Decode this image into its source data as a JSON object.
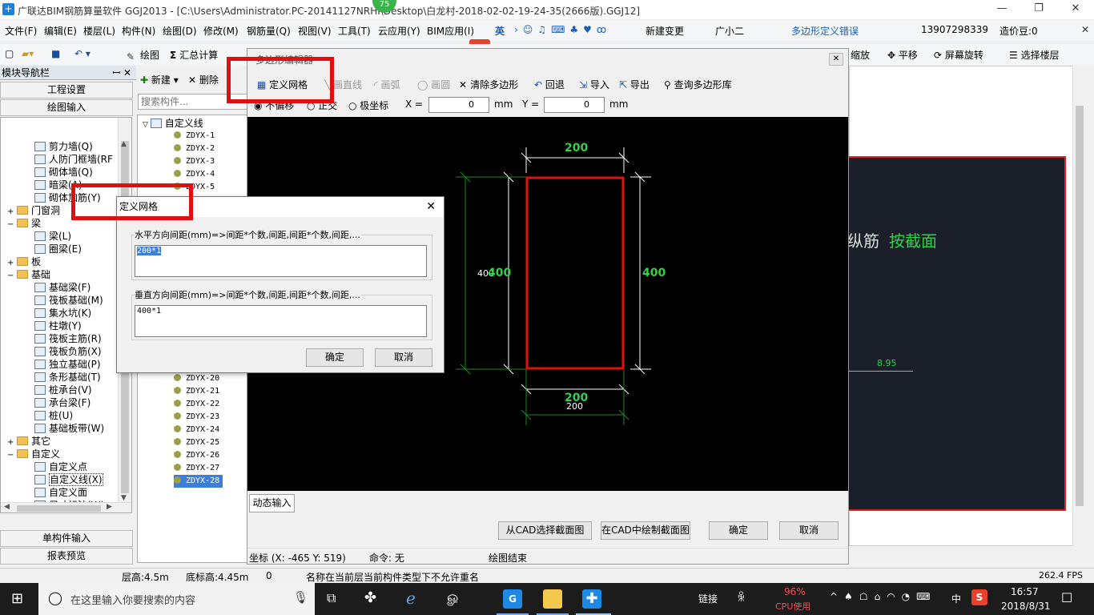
{
  "app": {
    "title": "广联达BIM钢筋算量软件 GGJ2013 - [C:\\Users\\Administrator.PC-20141127NRHI\\Desktop\\白龙村-2018-02-02-19-24-35(2666版).GGJ12]",
    "badge": "75"
  },
  "menu": {
    "items": [
      "文件(F)",
      "编辑(E)",
      "楼层(L)",
      "构件(N)",
      "绘图(D)",
      "修改(M)",
      "钢筋量(Q)",
      "视图(V)",
      "工具(T)",
      "云应用(Y)",
      "BIM应用(I)"
    ],
    "ime": "英",
    "new_change": "新建变更",
    "assistant": "广小二",
    "error_msg": "多边形定义错误",
    "phone": "13907298339",
    "cost": "造价豆:0"
  },
  "toolbar": {
    "draw": "绘图",
    "sum": "汇总计算",
    "zoom": "缩放",
    "pan": "平移",
    "rotate": "屏幕旋转",
    "select_floor": "选择楼层"
  },
  "nav": {
    "title": "模块导航栏",
    "pin": "꜖ ×",
    "project_settings": "工程设置",
    "drawing_input": "绘图输入",
    "single_input": "单构件输入",
    "report": "报表预览",
    "tree": [
      {
        "label": "剪力墙(Q)",
        "level": 2
      },
      {
        "label": "人防门框墙(RF",
        "level": 2
      },
      {
        "label": "砌体墙(Q)",
        "level": 2
      },
      {
        "label": "暗梁(A)",
        "level": 2
      },
      {
        "label": "砌体加筋(Y)",
        "level": 2
      },
      {
        "label": "门窗洞",
        "level": 1,
        "folder": true,
        "exp": "+"
      },
      {
        "label": "梁",
        "level": 1,
        "folder": true,
        "exp": "−"
      },
      {
        "label": "梁(L)",
        "level": 2
      },
      {
        "label": "圈梁(E)",
        "level": 2
      },
      {
        "label": "板",
        "level": 1,
        "folder": true,
        "exp": "+"
      },
      {
        "label": "基础",
        "level": 1,
        "folder": true,
        "exp": "−"
      },
      {
        "label": "基础梁(F)",
        "level": 2
      },
      {
        "label": "筏板基础(M)",
        "level": 2
      },
      {
        "label": "集水坑(K)",
        "level": 2
      },
      {
        "label": "柱墩(Y)",
        "level": 2
      },
      {
        "label": "筏板主筋(R)",
        "level": 2
      },
      {
        "label": "筏板负筋(X)",
        "level": 2
      },
      {
        "label": "独立基础(P)",
        "level": 2
      },
      {
        "label": "条形基础(T)",
        "level": 2
      },
      {
        "label": "桩承台(V)",
        "level": 2
      },
      {
        "label": "承台梁(F)",
        "level": 2
      },
      {
        "label": "桩(U)",
        "level": 2
      },
      {
        "label": "基础板带(W)",
        "level": 2
      },
      {
        "label": "其它",
        "level": 1,
        "folder": true,
        "exp": "+"
      },
      {
        "label": "自定义",
        "level": 1,
        "folder": true,
        "exp": "−"
      },
      {
        "label": "自定义点",
        "level": 2
      },
      {
        "label": "自定义线(X)",
        "level": 2,
        "selected": true
      },
      {
        "label": "自定义面",
        "level": 2
      },
      {
        "label": "尺寸标注(W)",
        "level": 2
      }
    ]
  },
  "components": {
    "new": "新建",
    "delete": "删除",
    "search_placeholder": "搜索构件...",
    "root": "自定义线",
    "top": [
      "ZDYX-1",
      "ZDYX-2",
      "ZDYX-3",
      "ZDYX-4",
      "ZDYX-5"
    ],
    "bottom": [
      "ZDYX-20",
      "ZDYX-21",
      "ZDYX-22",
      "ZDYX-23",
      "ZDYX-24",
      "ZDYX-25",
      "ZDYX-26",
      "ZDYX-27",
      "ZDYX-28"
    ]
  },
  "editor": {
    "title": "多边形编辑器",
    "define_grid": "定义网格",
    "draw_line": "画直线",
    "draw_arc": "画弧",
    "draw_circle": "画圆",
    "clear": "清除多边形",
    "undo": "回退",
    "import": "导入",
    "export": "导出",
    "query_lib": "查询多边形库",
    "radio_none": "不偏移",
    "radio_ortho": "正交",
    "radio_polar": "极坐标",
    "x_label": "X =",
    "y_label": "Y =",
    "x_val": "0",
    "y_val": "0",
    "unit": "mm",
    "dynamic_input": "动态输入",
    "btn_from_cad": "从CAD选择截面图",
    "btn_draw_cad": "在CAD中绘制截面图",
    "btn_ok": "确定",
    "btn_cancel": "取消",
    "coords": "坐标 (X: -465 Y: 519)",
    "command": "命令: 无",
    "draw_end": "绘图结束",
    "dims": {
      "top": "200",
      "bottom_green": "200",
      "bottom_white": "200",
      "left_white": "400",
      "left_green": "400",
      "right": "400"
    }
  },
  "dialog": {
    "title": "定义网格",
    "h_label": "水平方向间距(mm)=>间距*个数,间距,间距*个数,间距,...",
    "h_value": "200*1",
    "v_label": "垂直方向间距(mm)=>间距*个数,间距,间距*个数,间距,...",
    "v_value": "400*1",
    "ok": "确定",
    "cancel": "取消"
  },
  "rightpanel": {
    "text1": "纵筋",
    "text2": "按截面",
    "val": "8.95"
  },
  "status": {
    "floor_h": "层高:4.5m",
    "bottom_h": "底标高:4.45m",
    "zero": "0",
    "msg": "名称在当前层当前构件类型下不允许重名",
    "fps": "262.4 FPS"
  },
  "taskbar": {
    "search": "在这里输入你要搜索的内容",
    "link": "链接",
    "cpu_pct": "96%",
    "cpu_label": "CPU使用",
    "lang": "中",
    "time": "16:57",
    "date": "2018/8/31"
  }
}
